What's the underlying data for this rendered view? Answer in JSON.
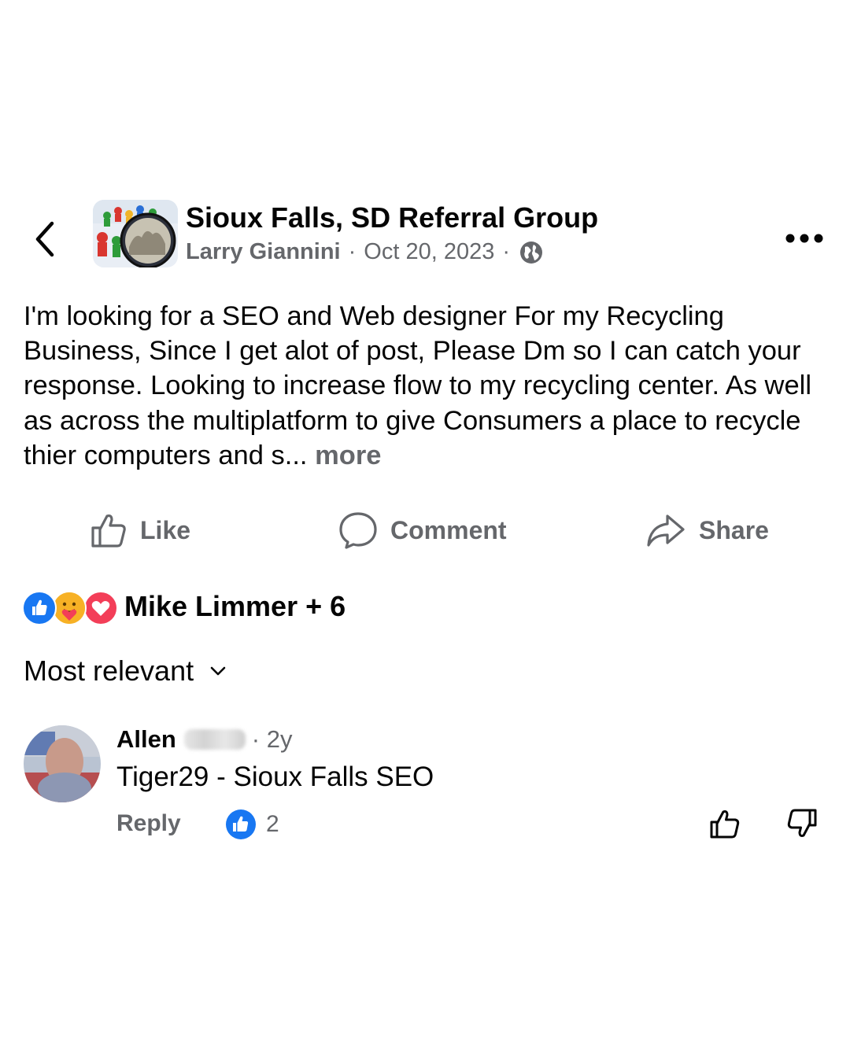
{
  "header": {
    "group_name": "Sioux Falls, SD Referral Group",
    "author": "Larry Giannini",
    "separator": "·",
    "date": "Oct 20, 2023",
    "visibility_icon": "globe-icon"
  },
  "post": {
    "text": "I'm looking for a SEO and Web designer For my Recycling Business, Since I get alot of post, Please Dm so I can catch your response. Looking to increase flow to my recycling center. As well as across the multiplatform to give Consumers a place to recycle thier computers and s...",
    "see_more": "more"
  },
  "actions": {
    "like": "Like",
    "comment": "Comment",
    "share": "Share"
  },
  "reactions": {
    "icons": [
      "like-reaction-icon",
      "care-reaction-icon",
      "love-reaction-icon"
    ],
    "summary": "Mike Limmer + 6"
  },
  "sort": {
    "label": "Most relevant"
  },
  "comments": [
    {
      "name": "Allen",
      "time": "· 2y",
      "text": "Tiger29 - Sioux Falls SEO",
      "reply_label": "Reply",
      "like_count": "2"
    }
  ],
  "colors": {
    "text_primary": "#050505",
    "text_secondary": "#65676b",
    "like_blue": "#1877f2",
    "love_red": "#f33e58",
    "care_yellow": "#f7b125"
  }
}
